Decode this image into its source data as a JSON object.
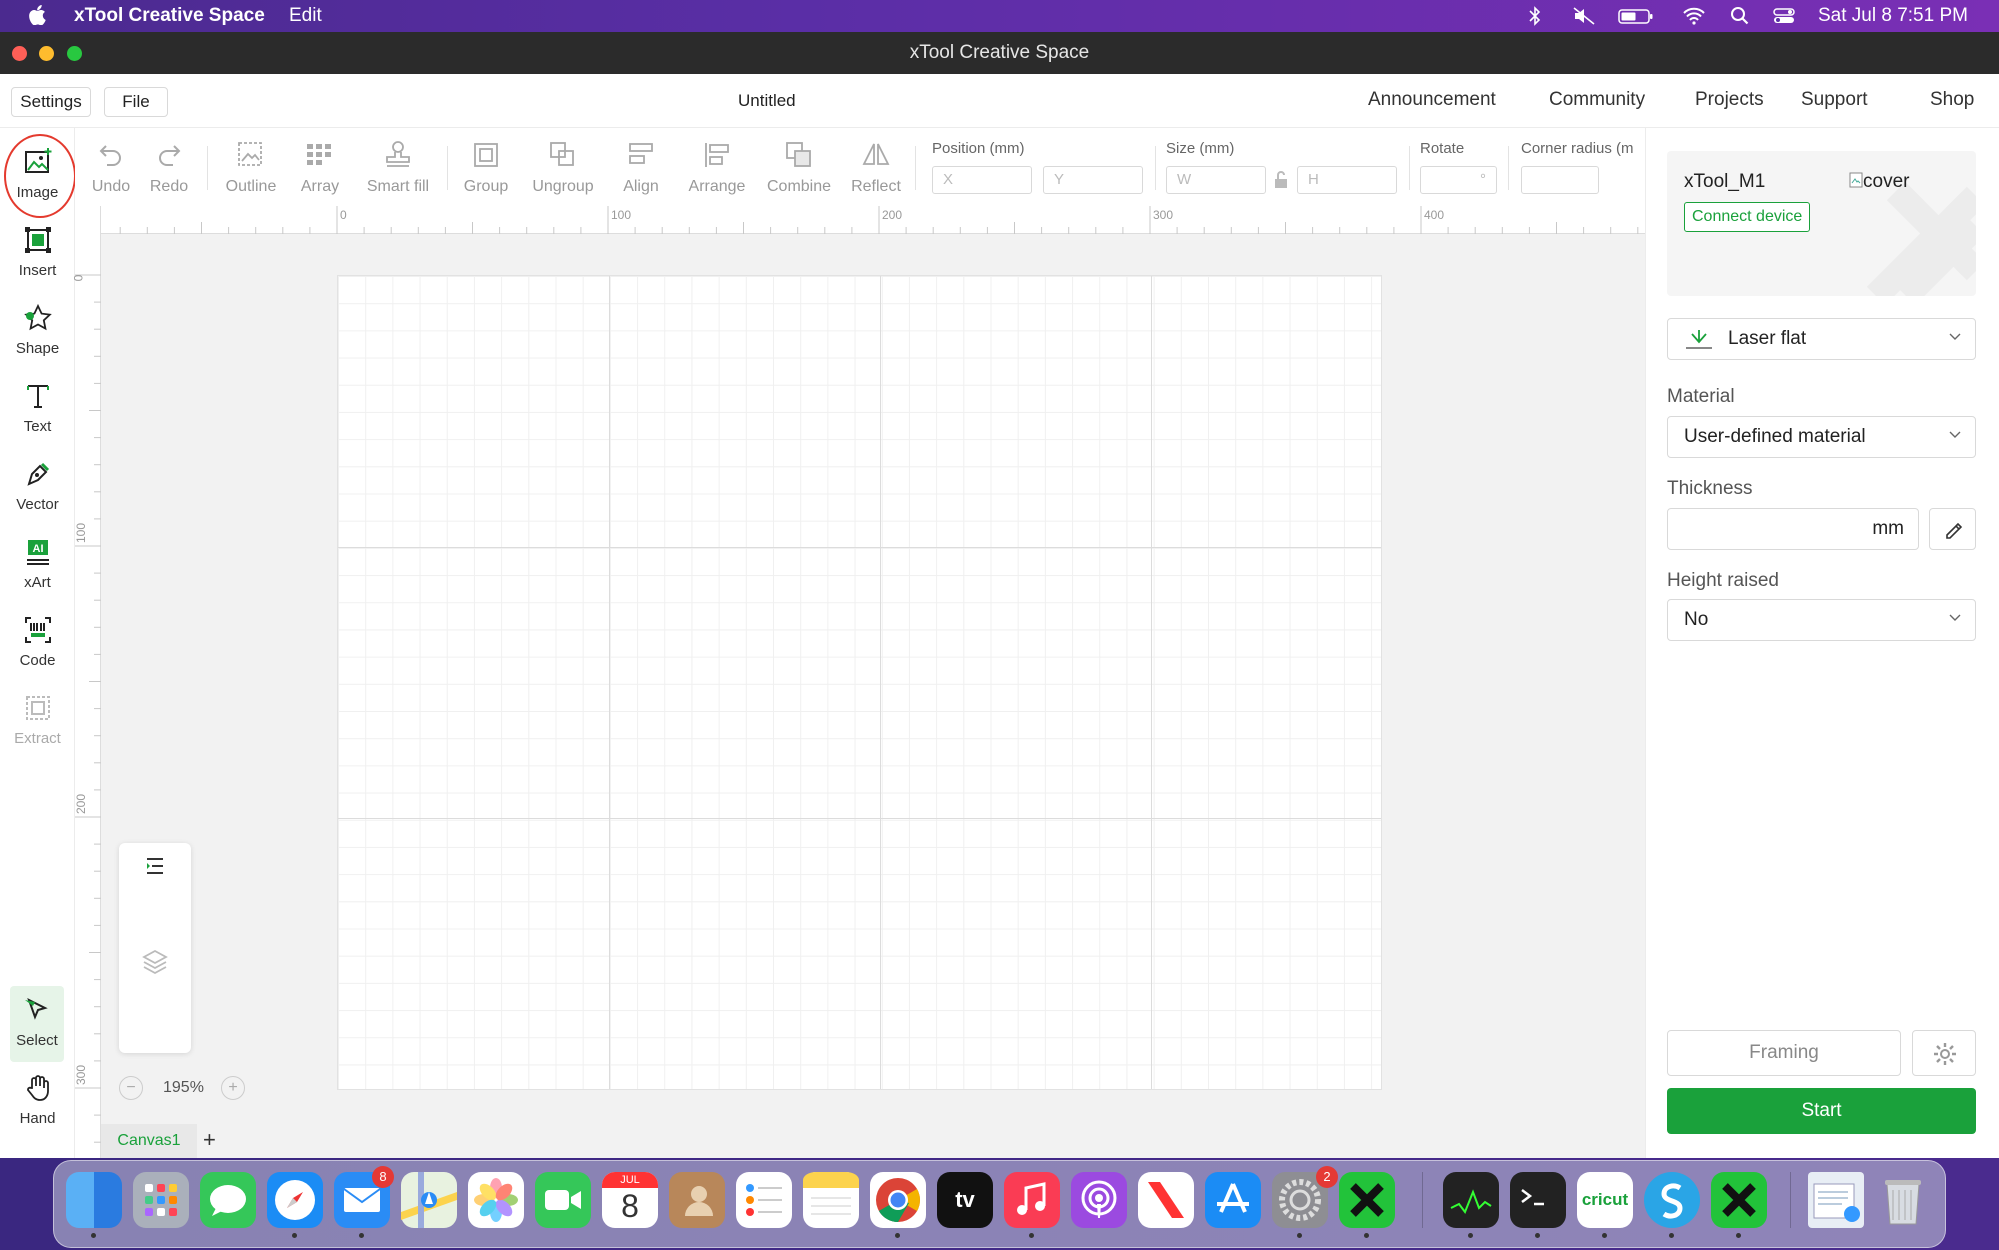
{
  "menubar": {
    "app_name": "xTool Creative Space",
    "edit": "Edit",
    "clock": "Sat Jul 8  7:51 PM"
  },
  "window": {
    "title": "xTool Creative Space"
  },
  "header": {
    "settings": "Settings",
    "file": "File",
    "document": "Untitled",
    "nav": [
      "Announcement",
      "Community",
      "Projects",
      "Support",
      "Shop"
    ]
  },
  "tools": [
    "Image",
    "Insert",
    "Shape",
    "Text",
    "Vector",
    "xArt",
    "Code",
    "Extract",
    "Select",
    "Hand"
  ],
  "toolbar": {
    "undo": "Undo",
    "redo": "Redo",
    "outline": "Outline",
    "array": "Array",
    "smart_fill": "Smart fill",
    "group": "Group",
    "ungroup": "Ungroup",
    "align": "Align",
    "arrange": "Arrange",
    "combine": "Combine",
    "reflect": "Reflect",
    "position_label": "Position (mm)",
    "x_ph": "X",
    "y_ph": "Y",
    "size_label": "Size (mm)",
    "w_ph": "W",
    "h_ph": "H",
    "rotate_label": "Rotate",
    "rotate_unit": "°",
    "corner_label": "Corner radius (m"
  },
  "ruler": {
    "h": [
      "0",
      "100",
      "200",
      "300",
      "400"
    ],
    "v": [
      "0",
      "100",
      "200",
      "300"
    ]
  },
  "canvas": {
    "zoom": "195%",
    "zoom_minus": "−",
    "zoom_plus": "+",
    "tab": "Canvas1",
    "add_tab": "+"
  },
  "device": {
    "name": "xTool_M1",
    "connect": "Connect device",
    "cover_alt": "cover"
  },
  "panel": {
    "mode": "Laser flat",
    "material_label": "Material",
    "material": "User-defined material",
    "thickness_label": "Thickness",
    "thickness_unit": "mm",
    "height_label": "Height raised",
    "height": "No",
    "framing": "Framing",
    "start": "Start"
  },
  "dock": {
    "mail_badge": "8",
    "settings_badge": "2",
    "calendar_month": "JUL",
    "calendar_day": "8",
    "cricut": "cricut",
    "appletv": "tv"
  },
  "colors": {
    "accent": "#1aa13b",
    "menubar": "#5a2ea6",
    "highlight_circle": "#e43a2e"
  }
}
